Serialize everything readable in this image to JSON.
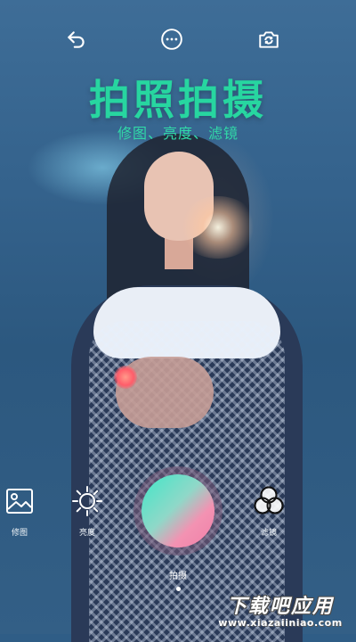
{
  "header": {
    "title": "拍照拍摄",
    "subtitle": "修图、亮度、滤镜",
    "icons": [
      "back-arrow-icon",
      "more-dots-icon",
      "camera-flip-icon"
    ]
  },
  "tools": [
    {
      "label": "修图",
      "icon": "image-icon"
    },
    {
      "label": "亮度",
      "icon": "sun-icon"
    },
    {
      "label": "滤镜",
      "icon": "filter-circles-icon"
    }
  ],
  "shutter": {
    "label": "拍摄"
  },
  "watermark": {
    "main": "下载吧应用",
    "url": "www.xiazaiiniao.com"
  },
  "colors": {
    "accent": "#27d6a0",
    "background": "#2f5d86",
    "shutter_start": "#3fe7c7",
    "shutter_end": "#f07fa8"
  }
}
